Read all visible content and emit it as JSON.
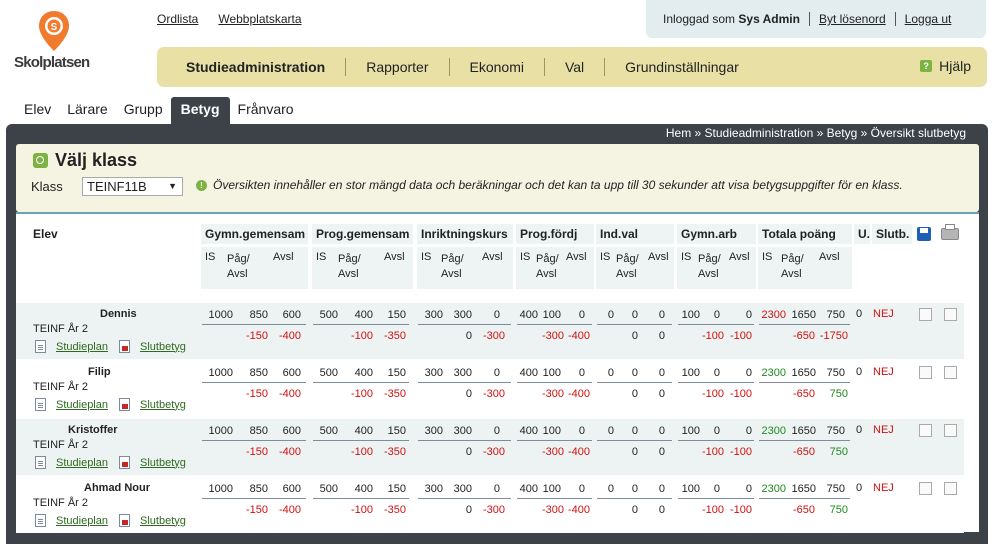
{
  "brand": {
    "name": "Skolplatsen",
    "pin_letter": "S",
    "accent": "#f07b2e"
  },
  "toplinks": [
    "Ordlista",
    "Webbplatskarta"
  ],
  "login": {
    "prefix": "Inloggad som",
    "user": "Sys Admin",
    "change_password": "Byt lösenord",
    "logout": "Logga ut"
  },
  "mainnav": [
    "Studieadministration",
    "Rapporter",
    "Ekonomi",
    "Val",
    "Grundinställningar"
  ],
  "help": "Hjälp",
  "subtabs": [
    "Elev",
    "Lärare",
    "Grupp",
    "Betyg",
    "Frånvaro"
  ],
  "breadcrumb": "Hem » Studieadministration » Betyg » Översikt slutbetyg",
  "panel": {
    "title": "Välj klass",
    "klass_label": "Klass",
    "klass_value": "TEINF11B",
    "info": "Översikten innehåller en stor mängd data och beräkningar och det kan ta upp till 30 sekunder att visa betygsuppgifter för en klass."
  },
  "table": {
    "elev_header": "Elev",
    "groups": [
      "Gymn.gemensam",
      "Prog.gemensam",
      "Inriktningskurs",
      "Prog.fördj",
      "Ind.val",
      "Gymn.arb",
      "Totala poäng"
    ],
    "u_header": "U.",
    "slutb_header": "Slutb.",
    "sub": {
      "is": "IS",
      "pag1": "Påg/",
      "pag2": "Avsl",
      "avsl": "Avsl"
    },
    "save_icon": "save-icon",
    "print_icon": "print-icon",
    "links": {
      "studieplan": "Studieplan",
      "slutbetyg": "Slutbetyg"
    },
    "students": [
      {
        "name": "Dennis",
        "class": "TEINF År 2",
        "top": [
          "1000",
          "850",
          "600",
          "500",
          "400",
          "150",
          "300",
          "300",
          "0",
          "400",
          "100",
          "0",
          "0",
          "0",
          "0",
          "100",
          "0",
          "0",
          "2300",
          "1650",
          "750"
        ],
        "diff": [
          "-150",
          "-400",
          "-100",
          "-350",
          "0",
          "-300",
          "-300",
          "-400",
          "0",
          "0",
          "-100",
          "-100",
          "-650",
          "-1750"
        ],
        "u": "0",
        "slutb": "NEJ",
        "total_is_color": "red",
        "last_diff_color": "red"
      },
      {
        "name": "Filip",
        "class": "TEINF År 2",
        "top": [
          "1000",
          "850",
          "600",
          "500",
          "400",
          "150",
          "300",
          "300",
          "0",
          "400",
          "100",
          "0",
          "0",
          "0",
          "0",
          "100",
          "0",
          "0",
          "2300",
          "1650",
          "750"
        ],
        "diff": [
          "-150",
          "-400",
          "-100",
          "-350",
          "0",
          "-300",
          "-300",
          "-400",
          "0",
          "0",
          "-100",
          "-100",
          "-650",
          "750"
        ],
        "u": "0",
        "slutb": "NEJ",
        "total_is_color": "green",
        "last_diff_color": "green"
      },
      {
        "name": "Kristoffer",
        "class": "TEINF År 2",
        "top": [
          "1000",
          "850",
          "600",
          "500",
          "400",
          "150",
          "300",
          "300",
          "0",
          "400",
          "100",
          "0",
          "0",
          "0",
          "0",
          "100",
          "0",
          "0",
          "2300",
          "1650",
          "750"
        ],
        "diff": [
          "-150",
          "-400",
          "-100",
          "-350",
          "0",
          "-300",
          "-300",
          "-400",
          "0",
          "0",
          "-100",
          "-100",
          "-650",
          "750"
        ],
        "u": "0",
        "slutb": "NEJ",
        "total_is_color": "green",
        "last_diff_color": "green"
      },
      {
        "name": "Ahmad Nour",
        "class": "TEINF År 2",
        "top": [
          "1000",
          "850",
          "600",
          "500",
          "400",
          "150",
          "300",
          "300",
          "0",
          "400",
          "100",
          "0",
          "0",
          "0",
          "0",
          "100",
          "0",
          "0",
          "2300",
          "1650",
          "750"
        ],
        "diff": [
          "-150",
          "-400",
          "-100",
          "-350",
          "0",
          "-300",
          "-300",
          "-400",
          "0",
          "0",
          "-100",
          "-100",
          "-650",
          "750"
        ],
        "u": "0",
        "slutb": "NEJ",
        "total_is_color": "green",
        "last_diff_color": "green"
      }
    ]
  }
}
